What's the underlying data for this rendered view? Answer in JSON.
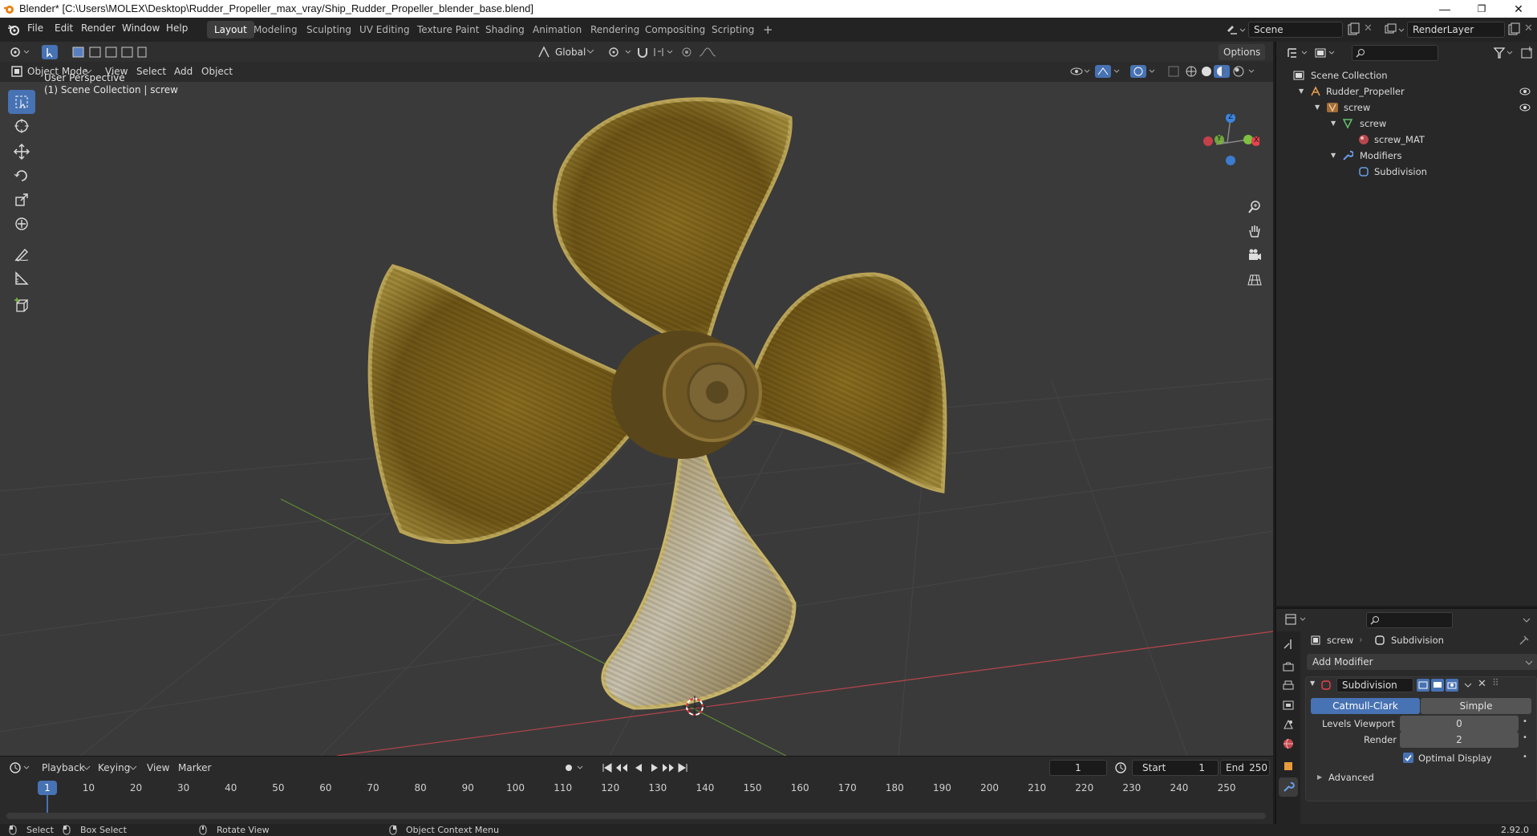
{
  "titlebar": {
    "title": "Blender* [C:\\Users\\MOLEX\\Desktop\\Rudder_Propeller_max_vray/Ship_Rudder_Propeller_blender_base.blend]",
    "minimize": "—",
    "maximize": "❐",
    "close": "✕"
  },
  "menu": {
    "file": "File",
    "edit": "Edit",
    "render": "Render",
    "window": "Window",
    "help": "Help"
  },
  "workspaces": [
    "Layout",
    "Modeling",
    "Sculpting",
    "UV Editing",
    "Texture Paint",
    "Shading",
    "Animation",
    "Rendering",
    "Compositing",
    "Scripting"
  ],
  "workspace_add": "+",
  "scene": {
    "name": "Scene",
    "view_layer": "RenderLayer"
  },
  "viewport": {
    "transform_orientation": "Global",
    "options_label": "Options",
    "mode": "Object Mode",
    "view": "View",
    "select": "Select",
    "add": "Add",
    "object": "Object",
    "perspective": "User Perspective",
    "collection_info": "(1) Scene Collection | screw",
    "gizmo": {
      "z": "Z",
      "y": "Y",
      "x": "X"
    },
    "colors": {
      "bg": "#3a3a3a",
      "accent": "#4772b3",
      "x_axis": "#e8424f",
      "y_axis": "#7fc040",
      "z_axis": "#3c84e0"
    }
  },
  "outliner": {
    "root": "Scene Collection",
    "items": [
      {
        "label": "Rudder_Propeller",
        "type": "empty"
      },
      {
        "label": "screw",
        "type": "object"
      },
      {
        "label": "screw",
        "type": "mesh"
      },
      {
        "label": "screw_MAT",
        "type": "material"
      },
      {
        "label": "Modifiers",
        "type": "modifiers"
      },
      {
        "label": "Subdivision",
        "type": "modifier"
      }
    ]
  },
  "properties": {
    "breadcrumb_object": "screw",
    "breadcrumb_modifier": "Subdivision",
    "add_modifier": "Add Modifier",
    "modifier_name": "Subdivision",
    "type_catmull": "Catmull-Clark",
    "type_simple": "Simple",
    "levels_viewport_label": "Levels Viewport",
    "levels_viewport_value": "0",
    "render_label": "Render",
    "render_value": "2",
    "optimal_display": "Optimal Display",
    "advanced": "Advanced"
  },
  "timeline": {
    "playback": "Playback",
    "keying": "Keying",
    "view": "View",
    "marker": "Marker",
    "current_frame": "1",
    "start_label": "Start",
    "start": "1",
    "end_label": "End",
    "end": "250",
    "ticks": [
      "10",
      "20",
      "30",
      "40",
      "50",
      "60",
      "70",
      "80",
      "90",
      "100",
      "110",
      "120",
      "130",
      "140",
      "150",
      "160",
      "170",
      "180",
      "190",
      "200",
      "210",
      "220",
      "230",
      "240",
      "250"
    ],
    "playhead": "1"
  },
  "statusbar": {
    "select": "Select",
    "box_select": "Box Select",
    "rotate_view": "Rotate View",
    "context_menu": "Object Context Menu",
    "version": "2.92.0"
  }
}
